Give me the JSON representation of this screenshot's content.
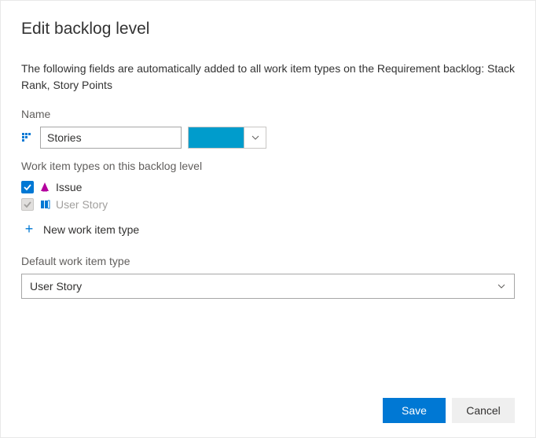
{
  "dialog": {
    "title": "Edit backlog level",
    "description": "The following fields are automatically added to all work item types on the Requirement backlog: Stack Rank, Story Points"
  },
  "name": {
    "label": "Name",
    "value": "Stories",
    "color": "#009ccc"
  },
  "workItemTypes": {
    "label": "Work item types on this backlog level",
    "items": [
      {
        "label": "Issue",
        "checked": true,
        "disabled": false
      },
      {
        "label": "User Story",
        "checked": true,
        "disabled": true
      }
    ],
    "newLabel": "New work item type"
  },
  "defaultWit": {
    "label": "Default work item type",
    "value": "User Story"
  },
  "footer": {
    "save": "Save",
    "cancel": "Cancel"
  }
}
